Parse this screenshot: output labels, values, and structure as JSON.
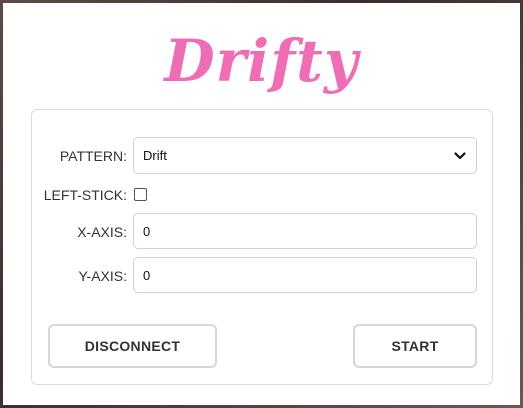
{
  "app": {
    "logo_text": "Drifty",
    "brand_color": "#f06cb4"
  },
  "form": {
    "pattern": {
      "label": "PATTERN:",
      "selected": "Drift"
    },
    "left_stick": {
      "label": "LEFT-STICK:",
      "checked": false
    },
    "x_axis": {
      "label": "X-AXIS:",
      "value": "0"
    },
    "y_axis": {
      "label": "Y-AXIS:",
      "value": "0"
    }
  },
  "actions": {
    "disconnect_label": "DISCONNECT",
    "start_label": "START"
  }
}
